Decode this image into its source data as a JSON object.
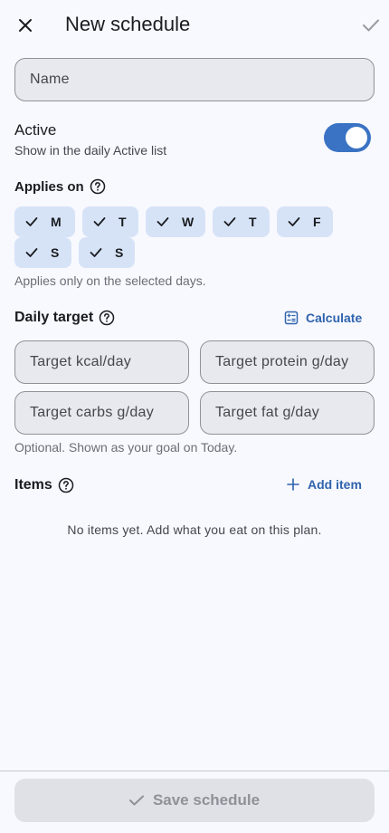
{
  "appbar": {
    "title": "New schedule"
  },
  "form": {
    "name_placeholder": "Name",
    "name_value": ""
  },
  "active": {
    "title": "Active",
    "subtitle": "Show in the daily Active list",
    "on": true
  },
  "applies_on": {
    "label": "Applies on",
    "days": [
      {
        "label": "M",
        "selected": true
      },
      {
        "label": "T",
        "selected": true
      },
      {
        "label": "W",
        "selected": true
      },
      {
        "label": "T",
        "selected": true
      },
      {
        "label": "F",
        "selected": true
      },
      {
        "label": "S",
        "selected": true
      },
      {
        "label": "S",
        "selected": true
      }
    ],
    "hint": "Applies only on the selected days."
  },
  "daily_target": {
    "label": "Daily target",
    "calculate_label": "Calculate",
    "kcal_placeholder": "Target kcal/day",
    "protein_placeholder": "Target protein g/day",
    "carbs_placeholder": "Target carbs g/day",
    "fat_placeholder": "Target fat g/day",
    "hint": "Optional. Shown as your goal on Today."
  },
  "items": {
    "label": "Items",
    "add_label": "Add item",
    "empty_text": "No items yet. Add what you eat on this plan."
  },
  "footer": {
    "save_label": "Save schedule",
    "save_enabled": false
  },
  "colors": {
    "accent": "#3a73c3",
    "chip_bg": "#d6e3f7",
    "link": "#2f63ad",
    "background": "#f8f9fe"
  },
  "icons": {
    "close": "close-icon",
    "confirm": "check-icon",
    "help": "help-circle-icon",
    "calculate": "calculator-icon",
    "add": "plus-icon"
  }
}
